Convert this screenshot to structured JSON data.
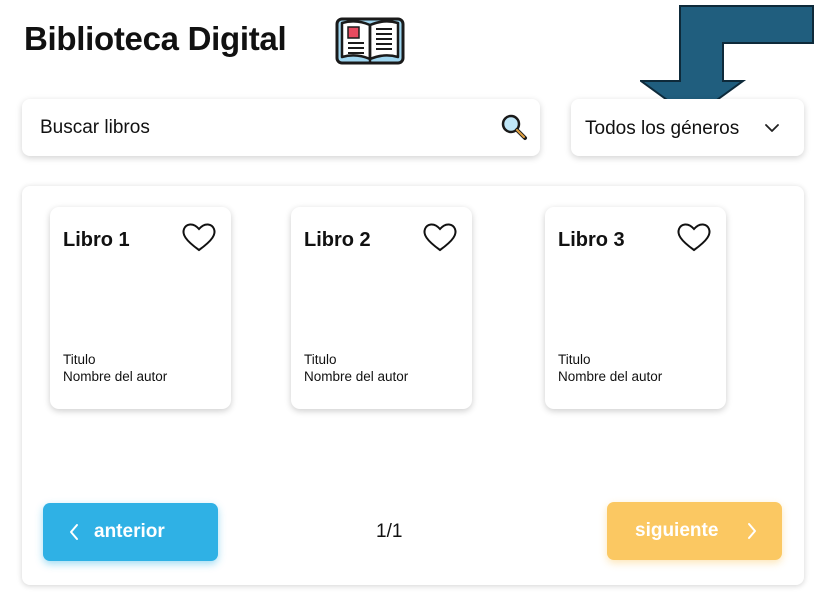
{
  "header": {
    "title": "Biblioteca Digital",
    "icon": "open-book-icon"
  },
  "search": {
    "placeholder": "Buscar libros",
    "icon": "magnifier-icon"
  },
  "genre_filter": {
    "selected": "Todos los géneros",
    "icon": "chevron-down-icon"
  },
  "books": [
    {
      "title": "Libro 1",
      "meta_title": "Titulo",
      "author": "Nombre del autor",
      "favorite": false
    },
    {
      "title": "Libro 2",
      "meta_title": "Titulo",
      "author": "Nombre del autor",
      "favorite": false
    },
    {
      "title": "Libro 3",
      "meta_title": "Titulo",
      "author": "Nombre del autor",
      "favorite": false
    }
  ],
  "pagination": {
    "prev_label": "anterior",
    "next_label": "siguiente",
    "page_indicator": "1/1"
  },
  "colors": {
    "prev_button": "#2fb1e5",
    "next_button": "#fbc862",
    "arrow_annotation": "#205e7e"
  }
}
